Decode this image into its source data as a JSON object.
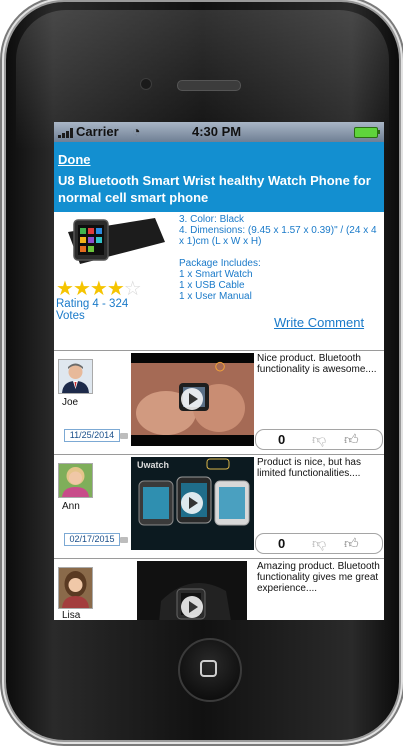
{
  "status_bar": {
    "carrier": "Carrier",
    "time": "4:30 PM"
  },
  "nav": {
    "done_label": "Done",
    "title": "U8 Bluetooth Smart Wrist healthy Watch Phone for normal cell smart phone"
  },
  "product": {
    "details": [
      "3. Color: Black",
      "4. Dimensions: (9.45 x 1.57 x 0.39)\" / (24 x 4 x 1)cm (L x W x H)"
    ],
    "package_heading": "Package Includes:",
    "package_items": [
      "1 x Smart Watch",
      "1 x USB Cable",
      "1 x User Manual"
    ],
    "rating_value": 4,
    "rating_max": 5,
    "rating_text": "Rating 4 - 324 Votes",
    "write_comment_label": "Write Comment"
  },
  "reviews": [
    {
      "name": "Joe",
      "date": "11/25/2014",
      "comment": "Nice product. Bluetooth functionality is awesome....",
      "votes": "0"
    },
    {
      "name": "Ann",
      "date": "02/17/2015",
      "comment": "Product is nice, but has limited functionalities....",
      "votes": "0"
    },
    {
      "name": "Lisa",
      "date": "",
      "comment": "Amazing product. Bluetooth functionality gives me great experience....",
      "votes": ""
    }
  ],
  "video_labels": {
    "second_brand": "Uwatch"
  },
  "colors": {
    "nav_blue": "#138fd0",
    "link_blue": "#1a7ac9",
    "star_gold": "#f5c400"
  },
  "icons": [
    "signal-icon",
    "wifi-icon",
    "battery-icon",
    "star-icon",
    "play-icon",
    "thumbs-down-icon",
    "thumbs-up-icon",
    "home-button-icon"
  ]
}
